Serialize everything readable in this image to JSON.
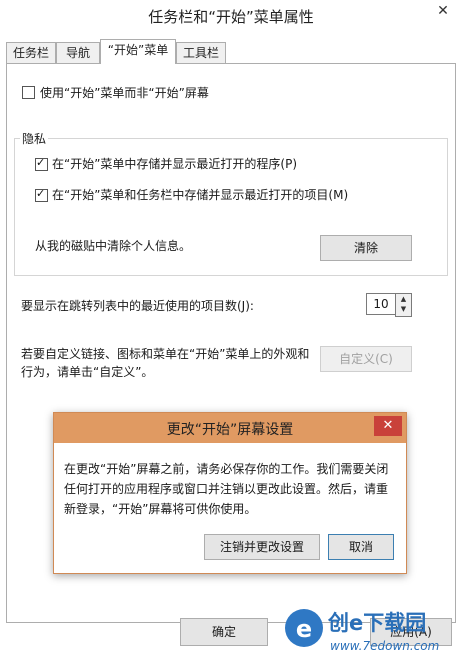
{
  "window": {
    "title": "任务栏和“开始”菜单属性",
    "close_glyph": "✕"
  },
  "tabs": [
    {
      "label": "任务栏"
    },
    {
      "label": "导航"
    },
    {
      "label": "“开始”菜单"
    },
    {
      "label": "工具栏"
    }
  ],
  "options": {
    "use_start_label": "使用“开始”菜单而非“开始”屏幕",
    "use_start_checked": false
  },
  "privacy": {
    "legend": "隐私",
    "store_programs_label": "在“开始”菜单中存储并显示最近打开的程序(P)",
    "store_programs_checked": true,
    "store_items_label": "在“开始”菜单和任务栏中存储并显示最近打开的项目(M)",
    "store_items_checked": true,
    "clear_info_label": "从我的磁贴中清除个人信息。",
    "clear_button": "清除"
  },
  "jumplist": {
    "label": "要显示在跳转列表中的最近使用的项目数(J):",
    "value": "10"
  },
  "customize": {
    "text_line1": "若要自定义链接、图标和菜单在“开始”菜单上的外观和",
    "text_line2": "行为，请单击“自定义”。",
    "button": "自定义(C)"
  },
  "dialog": {
    "title": "更改“开始”屏幕设置",
    "close_glyph": "✕",
    "message": "在更改“开始”屏幕之前，请务必保存你的工作。我们需要关闭任何打开的应用程序或窗口并注销以更改此设置。然后，请重新登录，“开始”屏幕将可供你使用。",
    "sign_out_button": "注销并更改设置",
    "cancel_button": "取消"
  },
  "footer": {
    "ok_button": "确定",
    "apply_button": "应用(A)"
  },
  "watermark": {
    "text": "创e下载园",
    "url": "www.7edown.com"
  },
  "colors": {
    "dialog_title_bg": "#e09a62",
    "dialog_close_bg": "#c9413a",
    "accent_blue": "#3c7fb1"
  }
}
